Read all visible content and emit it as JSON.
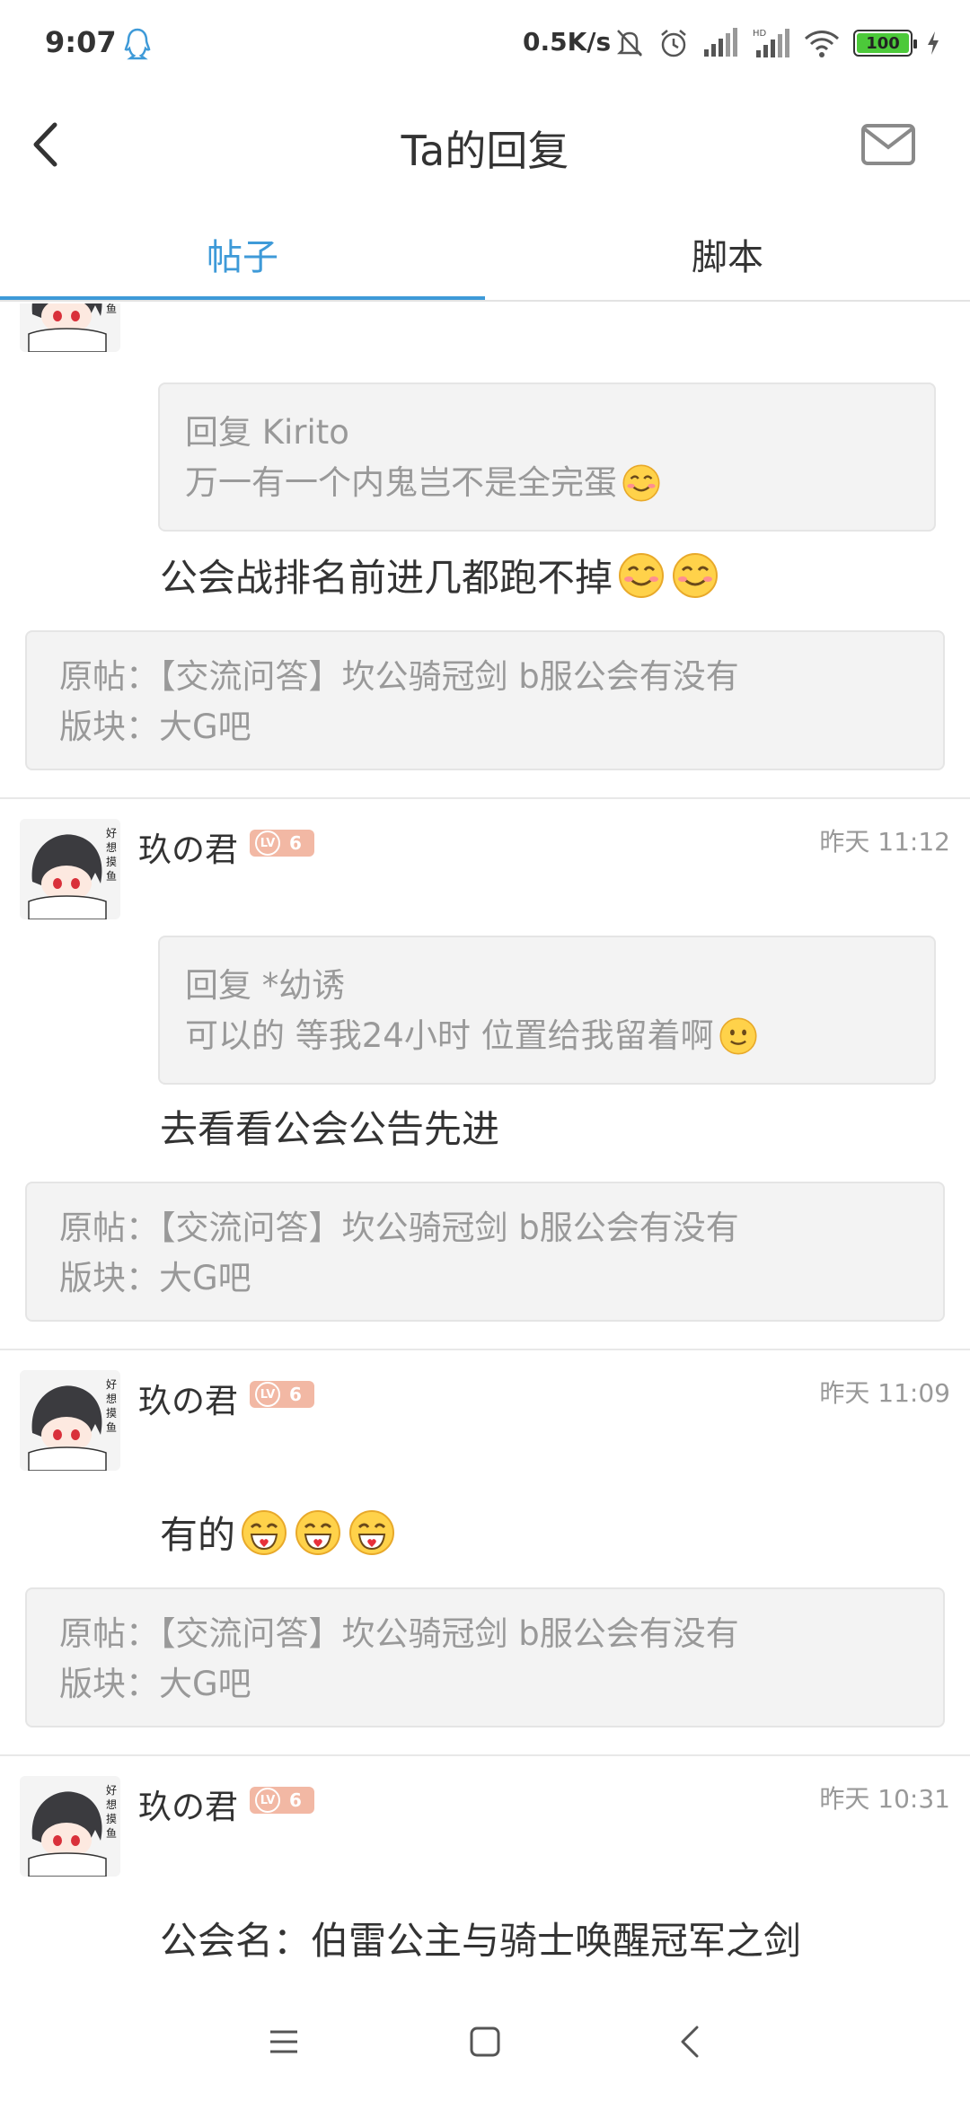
{
  "status": {
    "time": "9:07",
    "speed": "0.5K/s",
    "battery": "100"
  },
  "header": {
    "title": "Ta的回复"
  },
  "tabs": [
    {
      "label": "帖子",
      "active": true
    },
    {
      "label": "脚本",
      "active": false
    }
  ],
  "posts": [
    {
      "quote_line1": "回复 Kirito",
      "quote_line2": "万一有一个内鬼岂不是全完蛋",
      "reply": "公会战排名前进几都跑不掉",
      "origin_line1": "原帖：【交流问答】坎公骑冠剑 b服公会有没有",
      "origin_line2": "版块：大G吧"
    },
    {
      "user": "玖の君",
      "level_tag": "LV",
      "level": "6",
      "time": "昨天 11:12",
      "quote_line1": "回复 *幼诱",
      "quote_line2": "可以的  等我24小时  位置给我留着啊",
      "reply": "去看看公会公告先进",
      "origin_line1": "原帖：【交流问答】坎公骑冠剑 b服公会有没有",
      "origin_line2": "版块：大G吧"
    },
    {
      "user": "玖の君",
      "level_tag": "LV",
      "level": "6",
      "time": "昨天 11:09",
      "reply": "有的",
      "origin_line1": "原帖：【交流问答】坎公骑冠剑 b服公会有没有",
      "origin_line2": "版块：大G吧"
    },
    {
      "user": "玖の君",
      "level_tag": "LV",
      "level": "6",
      "time": "昨天 10:31",
      "reply": "公会名：伯雷公主与骑士唤醒冠军之剑"
    }
  ],
  "colors": {
    "accent": "#3e9ad8",
    "level_badge": "#f2b8a4",
    "card_bg": "#f3f3f3"
  }
}
